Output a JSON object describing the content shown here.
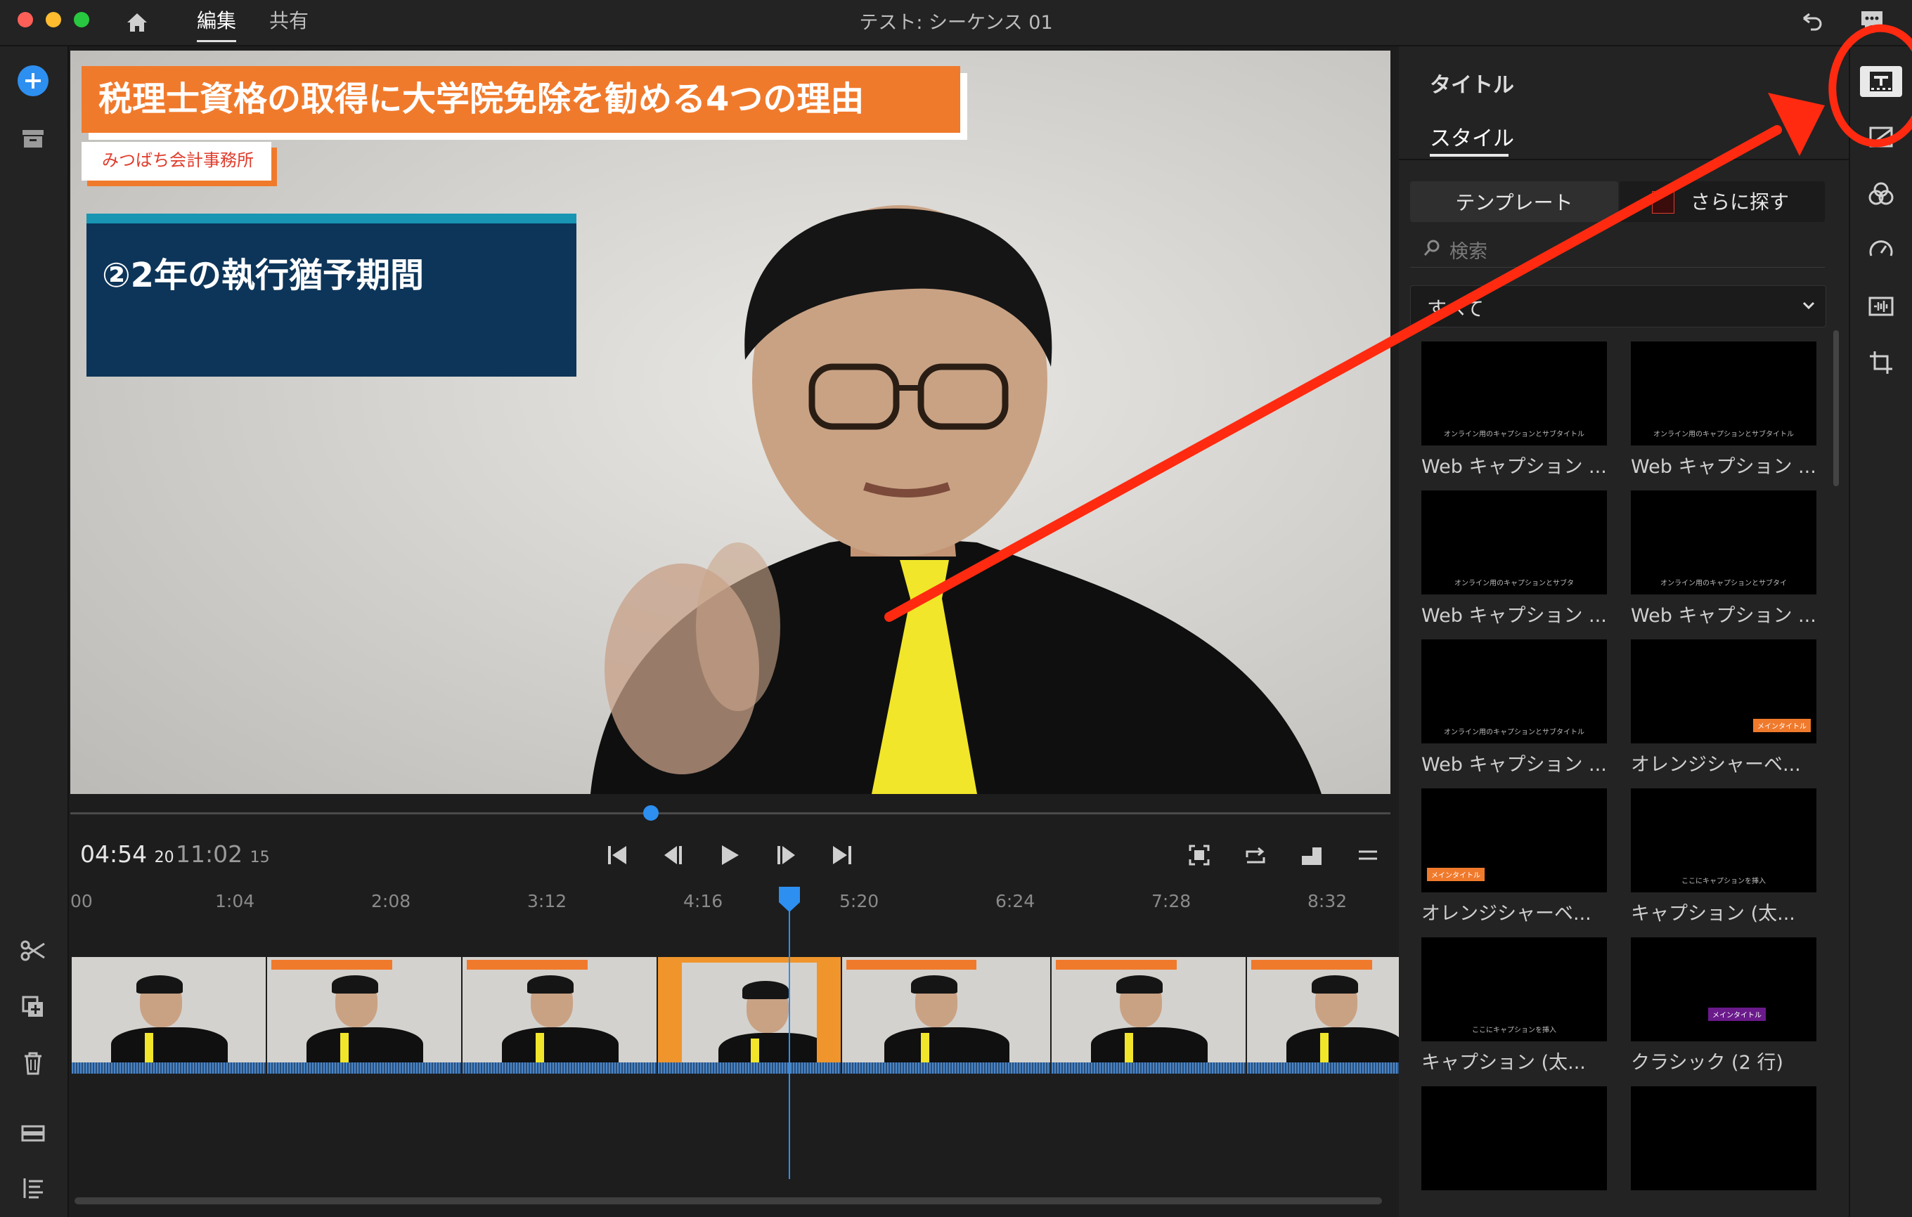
{
  "app": {
    "tabs": {
      "edit": "編集",
      "share": "共有"
    },
    "sequence_title": "テスト: シーケンス 01"
  },
  "preview": {
    "main_title": "税理士資格の取得に大学院免除を勧める4つの理由",
    "subtitle": "みつばち会計事務所",
    "point_text": "②2年の執行猶予期間"
  },
  "playback": {
    "current_time": "04:54",
    "current_frames": "20",
    "duration": "11:02",
    "duration_frames": "15",
    "playhead_progress": 0.44
  },
  "timeline": {
    "ruler": [
      "00",
      "1:04",
      "2:08",
      "3:12",
      "4:16",
      "5:20",
      "6:24",
      "7:28",
      "8:32"
    ],
    "clip_caption": "税理士資格の取得に大学院免除を勧める4つの理由"
  },
  "panel": {
    "heading": "タイトル",
    "tab_style": "スタイル",
    "btn_template": "テンプレート",
    "btn_more": "さらに探す",
    "search_placeholder": "検索",
    "filter_value": "すべて",
    "templates": [
      {
        "label": "Web キャプション ...",
        "inner": "オンライン用のキャプションとサブタイトル"
      },
      {
        "label": "Web キャプション ...",
        "inner": "オンライン用のキャプションとサブタイトル"
      },
      {
        "label": "Web キャプション ...",
        "inner": "オンライン用のキャプションとサブタ"
      },
      {
        "label": "Web キャプション ...",
        "inner": "オンライン用のキャプションとサブタイ"
      },
      {
        "label": "Web キャプション ...",
        "inner": "オンライン用のキャプションとサブタイトル"
      },
      {
        "label": "オレンジシャーベ...",
        "inner": "メインタイトル"
      },
      {
        "label": "オレンジシャーベ...",
        "inner": "メインタイトル"
      },
      {
        "label": "キャプション (太...",
        "inner": "ここにキャプションを挿入"
      },
      {
        "label": "キャプション (太...",
        "inner": "ここにキャプションを挿入"
      },
      {
        "label": "クラシック (2 行)",
        "inner": "メインタイトル"
      },
      {
        "label": "",
        "inner": ""
      },
      {
        "label": "",
        "inner": ""
      }
    ]
  },
  "colors": {
    "accent_blue": "#2d8ff0",
    "annotation_red": "#ff2a10",
    "title_orange": "#f07a2c",
    "navy": "#0d3559",
    "tie_yellow": "#f1e62a"
  },
  "icons": [
    "home-icon",
    "add-icon",
    "archive-icon",
    "undo-icon",
    "feedback-icon",
    "scissors-icon",
    "duplicate-icon",
    "trash-icon",
    "track-icon",
    "list-icon",
    "titles-icon",
    "transitions-icon",
    "color-icon",
    "speed-icon",
    "audio-icon",
    "crop-icon"
  ]
}
